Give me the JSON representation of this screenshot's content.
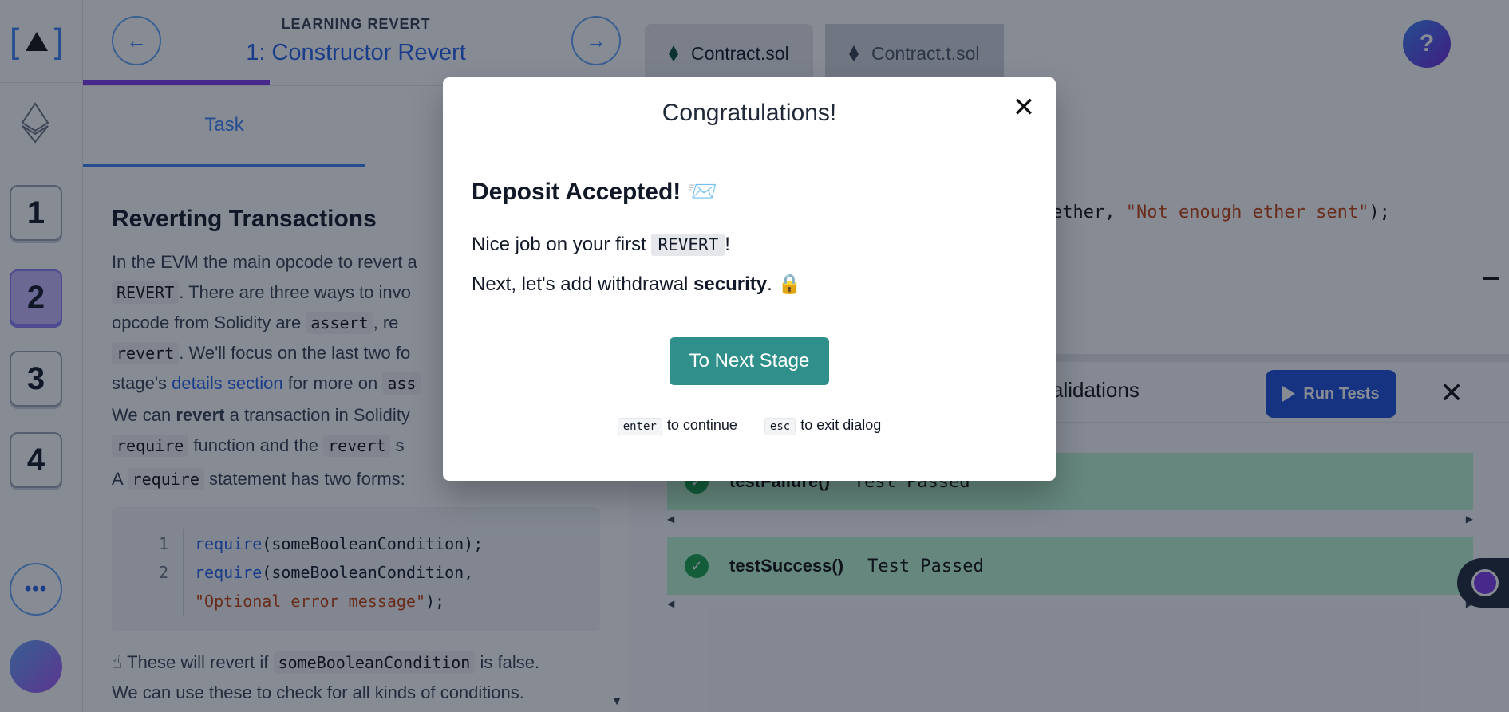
{
  "rail": {
    "logo_text": "[ ]",
    "stages": [
      "1",
      "2",
      "3",
      "4"
    ],
    "active_stage": "2",
    "more_label": "•••"
  },
  "lesson_header": {
    "kicker": "LEARNING REVERT",
    "title": "1: Constructor Revert",
    "prev_icon": "←",
    "next_icon": "→"
  },
  "task_tabs": {
    "task_label": "Task"
  },
  "lesson": {
    "heading": "Reverting Transactions",
    "p1_a": "In the EVM the main opcode to revert a",
    "p1_b": "REVERT",
    "p1_c": ". There are three ways to invo",
    "p1_d": "opcode from Solidity are",
    "p1_e": "assert",
    "p1_f": ", re",
    "p1_g": "revert",
    "p1_h": ". We'll focus on the last two fo",
    "p1_i": "stage's",
    "p1_link": "details section",
    "p1_j": "for more on",
    "p1_k": "ass",
    "p2_a": "We can",
    "p2_bold": "revert",
    "p2_b": "a transaction in Solidity",
    "p2_c": "require",
    "p2_d": "function and the",
    "p2_e": "revert",
    "p2_f": "s",
    "p3_a": "A",
    "p3_b": "require",
    "p3_c": "statement has two forms:",
    "code_lines": [
      {
        "num": "1",
        "kw": "require",
        "rest": "(someBooleanCondition);"
      },
      {
        "num": "2",
        "kw": "require",
        "rest": "(someBooleanCondition,"
      }
    ],
    "code_string_line": "\"Optional error message\"",
    "code_string_tail": ");",
    "p4_emoji": "☝",
    "p4_a": "These will revert if",
    "p4_b": "someBooleanCondition",
    "p4_c": "is false.",
    "p5": "We can use these to check for all kinds of conditions."
  },
  "editor": {
    "tabs": [
      "Contract.sol",
      "Contract.t.sol"
    ],
    "help_label": "?",
    "snippet_pre": "ether, ",
    "snippet_str": "\"Not enough ether sent\"",
    "snippet_post": ");"
  },
  "tests": {
    "header_label": "alidations",
    "run_label": "Run Tests",
    "close_icon": "✕",
    "rows": [
      {
        "name": "testFailure()",
        "status": "Test Passed"
      },
      {
        "name": "testSuccess()",
        "status": "Test Passed"
      }
    ]
  },
  "modal": {
    "title": "Congratulations!",
    "close_icon": "✕",
    "heading": "Deposit Accepted! 📨",
    "line1_a": "Nice job on your first",
    "line1_code": "REVERT",
    "line1_b": "!",
    "line2_a": "Next, let's add withdrawal",
    "line2_bold": "security",
    "line2_b": ". 🔒",
    "button_label": "To Next Stage",
    "hint1_key": "enter",
    "hint1_text": "to continue",
    "hint2_key": "esc",
    "hint2_text": "to exit dialog"
  },
  "colors": {
    "accent_blue": "#2563eb",
    "progress_purple": "#7c3aed",
    "next_button_teal": "#2f8f8a",
    "test_pass_green": "#bbf7d0"
  }
}
